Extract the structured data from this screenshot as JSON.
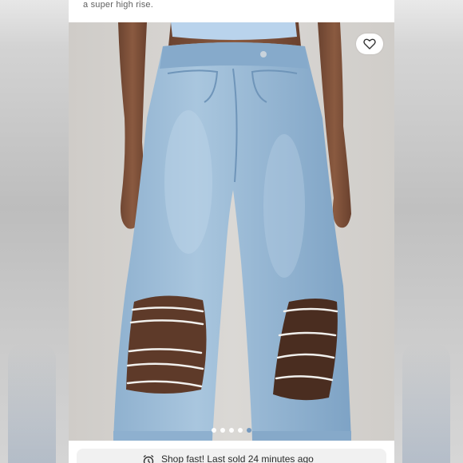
{
  "listing": {
    "description_tail": "a super high rise.",
    "product_image": {
      "alt": "",
      "slide_count": 5,
      "active_slide": 5
    },
    "like_icon": "heart-outline-icon",
    "urgency_banner": {
      "icon": "alarm-clock-icon",
      "text": "Shop fast! Last sold 24 minutes ago"
    }
  },
  "colors": {
    "page_bg": "#c9c9c9",
    "card_bg": "#ffffff",
    "denim_light": "#9fbfd8",
    "denim_mid": "#7ea4c6",
    "banner_bg": "#f1f1f1",
    "active_dot": "#4a7fb5"
  }
}
